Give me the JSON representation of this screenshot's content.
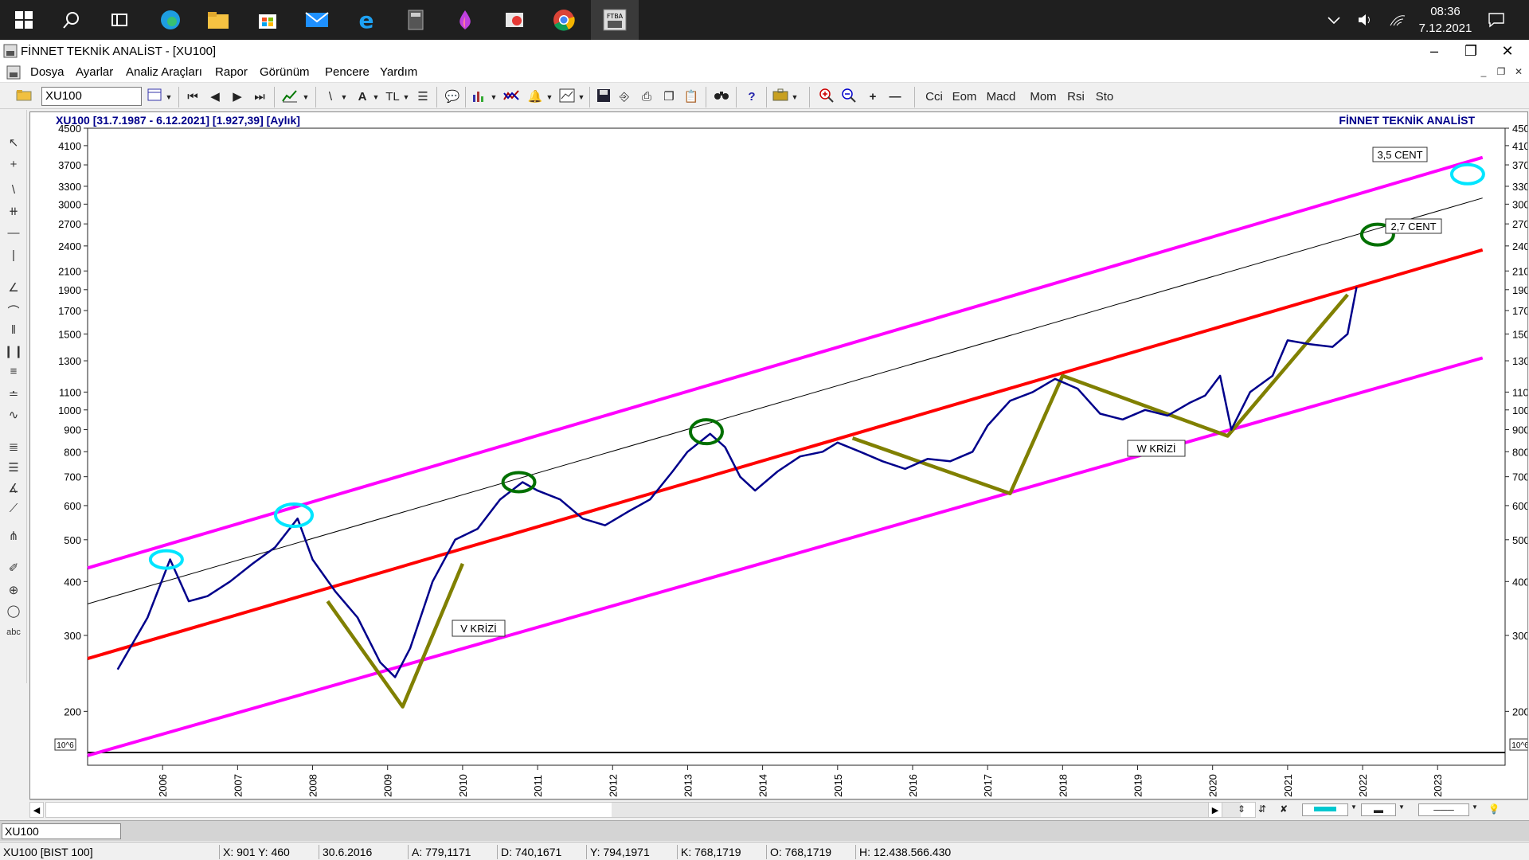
{
  "taskbar": {
    "time": "08:36",
    "date": "7.12.2021",
    "pinned": [
      "start-icon",
      "search-icon",
      "task-view-icon",
      "edge-icon",
      "file-explorer-icon",
      "store-icon",
      "mail-icon",
      "ie-icon",
      "calculator-icon",
      "paint-icon",
      "snip-icon",
      "chrome-icon",
      "finnet-icon"
    ]
  },
  "window": {
    "title": "FİNNET TEKNİK ANALİST - [XU100]"
  },
  "menu": [
    "Dosya",
    "Ayarlar",
    "Analiz Araçları",
    "Rapor",
    "Görünüm",
    "Pencere",
    "Yardım"
  ],
  "toolbar": {
    "symbol": "XU100",
    "currency": "TL",
    "indicators": [
      "Cci",
      "Eom",
      "Macd",
      "Mom",
      "Rsi",
      "Sto"
    ]
  },
  "chart": {
    "header": "XU100  [31.7.1987 - 6.12.2021]  [1.927,39]  [Aylık]",
    "brand": "FİNNET TEKNİK ANALİST",
    "scale_note": "10^6",
    "y_ticks": [
      "4500",
      "4100",
      "3700",
      "3300",
      "3000",
      "2700",
      "2400",
      "2100",
      "1900",
      "1700",
      "1500",
      "1300",
      "1100",
      "1000",
      "900",
      "800",
      "700",
      "600",
      "500",
      "400",
      "300",
      "200"
    ],
    "x_ticks": [
      "2006",
      "2007",
      "2008",
      "2009",
      "2010",
      "2011",
      "2012",
      "2013",
      "2014",
      "2015",
      "2016",
      "2017",
      "2018",
      "2019",
      "2020",
      "2021",
      "2022",
      "2023"
    ],
    "annotations": {
      "v_crisis": "V   KRİZİ",
      "w_crisis": "W   KRİZİ",
      "cent_35": "3,5 CENT",
      "cent_27": "2,7 CENT"
    },
    "colors": {
      "price": "#00008b",
      "channel": "#ff00ff",
      "midline": "#ff0000",
      "pattern": "#808000",
      "circle_top": "#00e5ff",
      "circle_mid": "#007000",
      "trendline": "#000000"
    }
  },
  "chart_data": {
    "type": "line",
    "title": "XU100  [31.7.1987 - 6.12.2021]  [1.927,39]  [Aylık]",
    "scale": "log",
    "ylim": [
      150,
      4500
    ],
    "series": [
      {
        "name": "XU100",
        "x": [
          2005.4,
          2005.8,
          2006.1,
          2006.35,
          2006.6,
          2006.9,
          2007.2,
          2007.5,
          2007.8,
          2008.0,
          2008.3,
          2008.6,
          2008.9,
          2009.1,
          2009.3,
          2009.6,
          2009.9,
          2010.2,
          2010.5,
          2010.8,
          2011.0,
          2011.3,
          2011.6,
          2011.9,
          2012.2,
          2012.5,
          2012.8,
          2013.0,
          2013.3,
          2013.5,
          2013.7,
          2013.9,
          2014.2,
          2014.5,
          2014.8,
          2015.0,
          2015.3,
          2015.6,
          2015.9,
          2016.2,
          2016.5,
          2016.8,
          2017.0,
          2017.3,
          2017.6,
          2017.9,
          2018.2,
          2018.5,
          2018.8,
          2019.1,
          2019.4,
          2019.7,
          2019.9,
          2020.1,
          2020.25,
          2020.5,
          2020.8,
          2021.0,
          2021.3,
          2021.6,
          2021.8,
          2021.92
        ],
        "values": [
          250,
          330,
          450,
          360,
          370,
          400,
          440,
          480,
          560,
          450,
          380,
          330,
          260,
          240,
          280,
          400,
          500,
          530,
          620,
          680,
          650,
          620,
          560,
          540,
          580,
          620,
          720,
          800,
          880,
          820,
          700,
          650,
          720,
          780,
          800,
          840,
          800,
          760,
          730,
          770,
          760,
          800,
          920,
          1050,
          1100,
          1180,
          1120,
          980,
          950,
          1000,
          970,
          1040,
          1080,
          1200,
          900,
          1100,
          1200,
          1450,
          1420,
          1400,
          1500,
          1927
        ]
      },
      {
        "name": "Upper channel",
        "x": [
          2005.0,
          2023.6
        ],
        "values": [
          430,
          3850
        ]
      },
      {
        "name": "Middle (red)",
        "x": [
          2005.0,
          2023.6
        ],
        "values": [
          265,
          2350
        ]
      },
      {
        "name": "Lower channel",
        "x": [
          2005.0,
          2023.6
        ],
        "values": [
          158,
          1320
        ]
      },
      {
        "name": "Trend (black)",
        "x": [
          2005.0,
          2023.6
        ],
        "values": [
          355,
          3100
        ]
      },
      {
        "name": "V pattern",
        "x": [
          2008.2,
          2009.2,
          2010.0
        ],
        "values": [
          360,
          205,
          440
        ]
      },
      {
        "name": "W pattern",
        "x": [
          2015.2,
          2017.3,
          2018.0,
          2020.2,
          2021.8
        ],
        "values": [
          860,
          640,
          1200,
          870,
          1850
        ]
      }
    ]
  },
  "status": {
    "tab": "XU100",
    "symbol": "XU100 [BIST 100]",
    "xy": "X: 901 Y: 460",
    "date": "30.6.2016",
    "a": "A: 779,1171",
    "d": "D: 740,1671",
    "y": "Y: 794,1971",
    "k": "K: 768,1719",
    "o": "O: 768,1719",
    "h": "H: 12.438.566.430"
  }
}
